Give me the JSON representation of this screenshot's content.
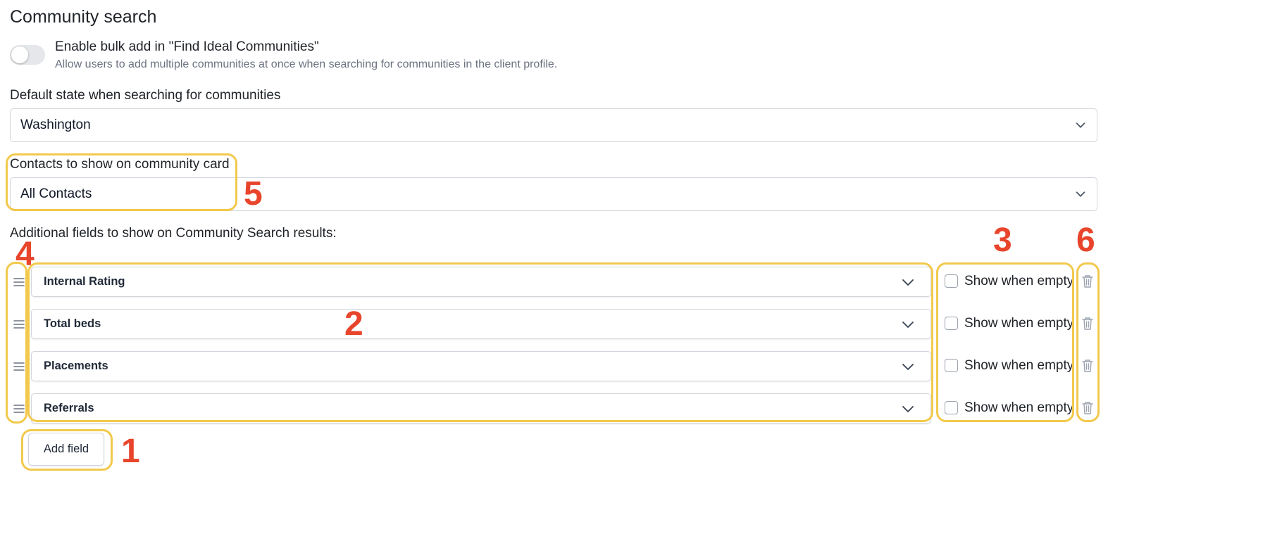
{
  "page": {
    "title": "Community search",
    "bulk_add": {
      "label": "Enable bulk add in \"Find Ideal Communities\"",
      "description": "Allow users to add multiple communities at once when searching for communities in the client profile.",
      "enabled": false
    },
    "default_state": {
      "label": "Default state when searching for communities",
      "value": "Washington"
    },
    "contacts": {
      "label": "Contacts to show on community card",
      "value": "All Contacts"
    },
    "additional_fields": {
      "label": "Additional fields to show on Community Search results:",
      "rows": [
        {
          "field": "Internal Rating",
          "show_when_empty_label": "Show when empty",
          "show_when_empty": false
        },
        {
          "field": "Total beds",
          "show_when_empty_label": "Show when empty",
          "show_when_empty": false
        },
        {
          "field": "Placements",
          "show_when_empty_label": "Show when empty",
          "show_when_empty": false
        },
        {
          "field": "Referrals",
          "show_when_empty_label": "Show when empty",
          "show_when_empty": false
        }
      ]
    },
    "add_field_button": "Add field"
  },
  "annotations": {
    "color_highlight": "#f2c94c",
    "color_number": "#e8452c",
    "n1": "1",
    "n2": "2",
    "n3": "3",
    "n4": "4",
    "n5": "5",
    "n6": "6"
  },
  "icons": [
    "chevron-down-icon",
    "drag-handle-icon",
    "trash-icon"
  ]
}
